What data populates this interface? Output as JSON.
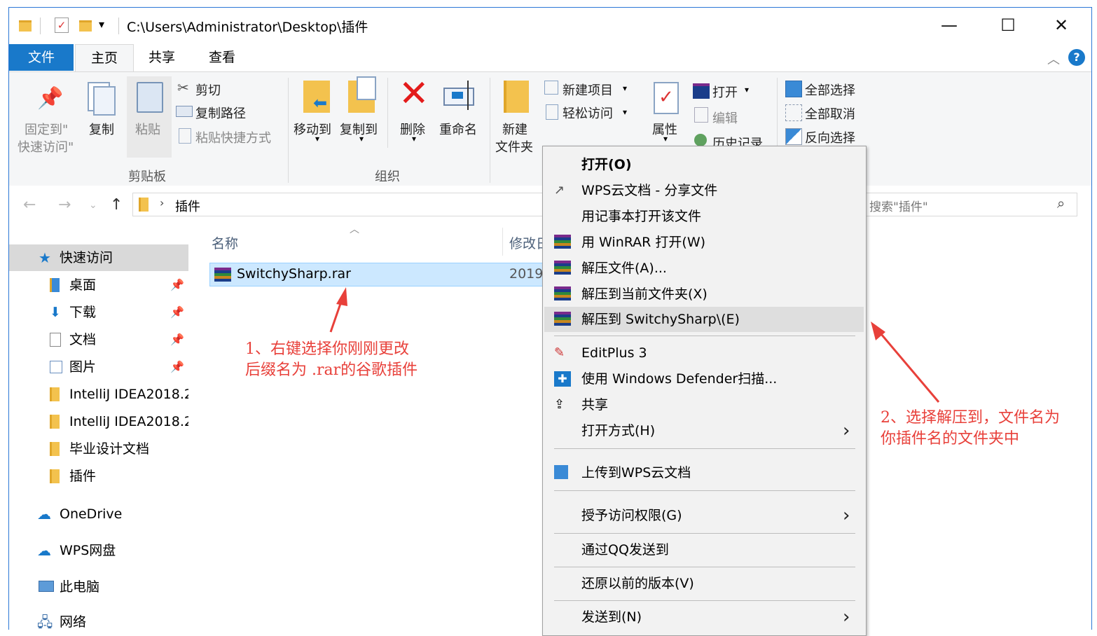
{
  "window": {
    "title_path": "C:\\Users\\Administrator\\Desktop\\插件",
    "controls": {
      "minimize": "—",
      "maximize": "☐",
      "close": "✕"
    }
  },
  "ribbon_tabs": [
    "文件",
    "主页",
    "共享",
    "查看"
  ],
  "ribbon": {
    "pin_label_1": "固定到\"",
    "pin_label_2": "快速访问\"",
    "copy": "复制",
    "paste": "粘贴",
    "cut": "剪切",
    "copy_path": "复制路径",
    "paste_shortcut": "粘贴快捷方式",
    "group_clipboard": "剪贴板",
    "move_to": "移动到",
    "copy_to": "复制到",
    "delete": "删除",
    "rename": "重命名",
    "group_organize": "组织",
    "new_folder_1": "新建",
    "new_folder_2": "文件夹",
    "new_item": "新建项目",
    "easy_access": "轻松访问",
    "properties": "属性",
    "open": "打开",
    "edit": "编辑",
    "history": "历史记录",
    "select_all": "全部选择",
    "select_none": "全部取消",
    "invert_selection": "反向选择"
  },
  "address": {
    "current": "插件",
    "search_placeholder": "搜索\"插件\""
  },
  "nav": {
    "quick_access": "快速访问",
    "items": [
      "桌面",
      "下载",
      "文档",
      "图片",
      "IntelliJ IDEA2018.2",
      "IntelliJ IDEA2018.2",
      "毕业设计文档",
      "插件"
    ],
    "onedrive": "OneDrive",
    "wps": "WPS网盘",
    "pc": "此电脑",
    "network": "网络"
  },
  "content": {
    "col_name": "名称",
    "col_modified": "修改日",
    "file_name": "SwitchySharp.rar",
    "file_date": "2019"
  },
  "context_menu": [
    {
      "label": "打开(O)"
    },
    {
      "label": "WPS云文档 - 分享文件"
    },
    {
      "label": "用记事本打开该文件"
    },
    {
      "label": "用 WinRAR 打开(W)"
    },
    {
      "label": "解压文件(A)..."
    },
    {
      "label": "解压到当前文件夹(X)"
    },
    {
      "label": "解压到 SwitchySharp\\(E)"
    },
    {
      "label": "EditPlus 3"
    },
    {
      "label": "使用 Windows Defender扫描..."
    },
    {
      "label": "共享"
    },
    {
      "label": "打开方式(H)"
    },
    {
      "label": "上传到WPS云文档"
    },
    {
      "label": "授予访问权限(G)"
    },
    {
      "label": "通过QQ发送到"
    },
    {
      "label": "还原以前的版本(V)"
    },
    {
      "label": "发送到(N)"
    }
  ],
  "annotations": {
    "a1_line1": "1、右键选择你刚刚更改",
    "a1_line2": "后缀名为 .rar的谷歌插件",
    "a2_line1": "2、选择解压到，文件名为",
    "a2_line2": "你插件名的文件夹中"
  },
  "colors": {
    "accent": "#1979ca",
    "selection": "#cce8ff",
    "annotation": "#e8403a",
    "folder": "#f3c24e"
  }
}
